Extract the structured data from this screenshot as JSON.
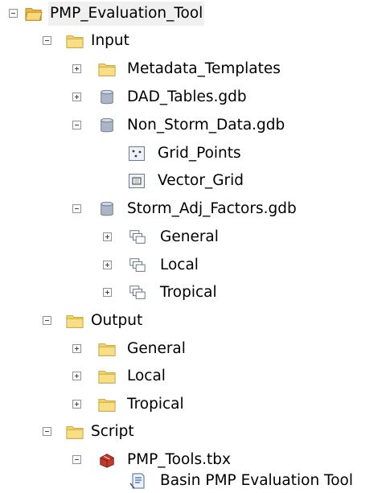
{
  "tree": {
    "root": {
      "label": "PMP_Evaluation_Tool",
      "expanded": true,
      "icon": "open-folder-icon"
    },
    "input": {
      "label": "Input",
      "expanded": true,
      "icon": "folder-icon",
      "metadata_templates": {
        "label": "Metadata_Templates",
        "expanded": false,
        "icon": "folder-icon"
      },
      "dad_tables": {
        "label": "DAD_Tables.gdb",
        "expanded": false,
        "icon": "geodatabase-icon"
      },
      "non_storm": {
        "label": "Non_Storm_Data.gdb",
        "expanded": true,
        "icon": "geodatabase-icon",
        "grid_points": {
          "label": "Grid_Points",
          "icon": "point-feature-class-icon"
        },
        "vector_grid": {
          "label": "Vector_Grid",
          "icon": "polygon-feature-class-icon"
        }
      },
      "storm_adj": {
        "label": "Storm_Adj_Factors.gdb",
        "expanded": true,
        "icon": "geodatabase-icon",
        "general": {
          "label": "General",
          "expanded": false,
          "icon": "feature-dataset-icon"
        },
        "local": {
          "label": "Local",
          "expanded": false,
          "icon": "feature-dataset-icon"
        },
        "tropical": {
          "label": "Tropical",
          "expanded": false,
          "icon": "feature-dataset-icon"
        }
      }
    },
    "output": {
      "label": "Output",
      "expanded": true,
      "icon": "folder-icon",
      "general": {
        "label": "General",
        "expanded": false,
        "icon": "folder-icon"
      },
      "local": {
        "label": "Local",
        "expanded": false,
        "icon": "folder-icon"
      },
      "tropical": {
        "label": "Tropical",
        "expanded": false,
        "icon": "folder-icon"
      }
    },
    "script": {
      "label": "Script",
      "expanded": true,
      "icon": "folder-icon",
      "toolbox": {
        "label": "PMP_Tools.tbx",
        "expanded": true,
        "icon": "toolbox-icon",
        "tool": {
          "label": "Basin PMP Evaluation Tool",
          "icon": "script-tool-icon"
        }
      }
    }
  },
  "colors": {
    "folder": "#f4d36c",
    "folder_border": "#c8a23a",
    "gdb": "#9aa9bc",
    "toolbox": "#c0392b"
  }
}
